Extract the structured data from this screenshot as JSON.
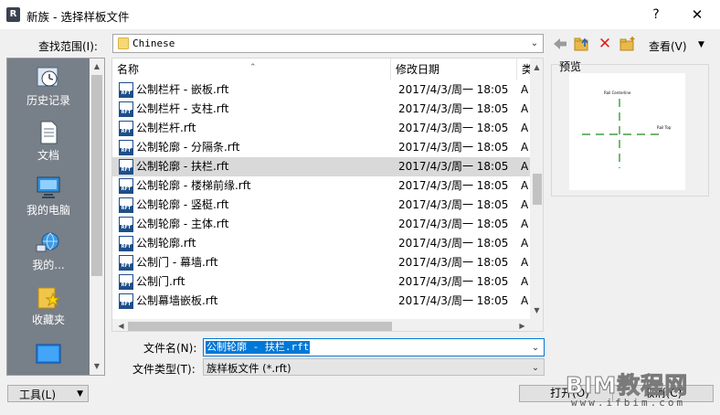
{
  "title_bar": {
    "title": "新族 - 选择样板文件",
    "app_icon": "R",
    "help_label": "?",
    "close_label": "✕"
  },
  "look_in": {
    "label": "查找范围(I):",
    "value": "Chinese"
  },
  "toolbar": {
    "views_label": "查看(V)"
  },
  "places": [
    {
      "label": "历史记录",
      "icon": "history-icon"
    },
    {
      "label": "文档",
      "icon": "documents-icon"
    },
    {
      "label": "我的电脑",
      "icon": "computer-icon"
    },
    {
      "label": "我的...",
      "icon": "network-icon"
    },
    {
      "label": "收藏夹",
      "icon": "favorites-icon"
    },
    {
      "label": "",
      "icon": "desktop-icon"
    }
  ],
  "file_list": {
    "columns": {
      "name": "名称",
      "date": "修改日期",
      "type": "类"
    },
    "rows": [
      {
        "name": "公制栏杆 - 嵌板.rft",
        "date": "2017/4/3/周一 18:05",
        "type": "A",
        "selected": false
      },
      {
        "name": "公制栏杆 - 支柱.rft",
        "date": "2017/4/3/周一 18:05",
        "type": "A",
        "selected": false
      },
      {
        "name": "公制栏杆.rft",
        "date": "2017/4/3/周一 18:05",
        "type": "A",
        "selected": false
      },
      {
        "name": "公制轮廓 - 分隔条.rft",
        "date": "2017/4/3/周一 18:05",
        "type": "A",
        "selected": false
      },
      {
        "name": "公制轮廓 - 扶栏.rft",
        "date": "2017/4/3/周一 18:05",
        "type": "A",
        "selected": true
      },
      {
        "name": "公制轮廓 - 楼梯前缘.rft",
        "date": "2017/4/3/周一 18:05",
        "type": "A",
        "selected": false
      },
      {
        "name": "公制轮廓 - 竖梃.rft",
        "date": "2017/4/3/周一 18:05",
        "type": "A",
        "selected": false
      },
      {
        "name": "公制轮廓 - 主体.rft",
        "date": "2017/4/3/周一 18:05",
        "type": "A",
        "selected": false
      },
      {
        "name": "公制轮廓.rft",
        "date": "2017/4/3/周一 18:05",
        "type": "A",
        "selected": false
      },
      {
        "name": "公制门 - 幕墙.rft",
        "date": "2017/4/3/周一 18:05",
        "type": "A",
        "selected": false
      },
      {
        "name": "公制门.rft",
        "date": "2017/4/3/周一 18:05",
        "type": "A",
        "selected": false
      },
      {
        "name": "公制幕墙嵌板.rft",
        "date": "2017/4/3/周一 18:05",
        "type": "A",
        "selected": false
      }
    ]
  },
  "preview": {
    "label": "预览",
    "rail_centerline": "Rail Centerline",
    "rail_top": "Rail Top"
  },
  "file_name": {
    "label": "文件名(N):",
    "value": "公制轮廓 - 扶栏.rft"
  },
  "file_type": {
    "label": "文件类型(T):",
    "value": "族样板文件 (*.rft)"
  },
  "buttons": {
    "tools": "工具(L)",
    "open": "打开(O)",
    "cancel": "取消(C)"
  },
  "watermark": {
    "main": "BIM教程网",
    "sub": "www.ifbim.com"
  }
}
